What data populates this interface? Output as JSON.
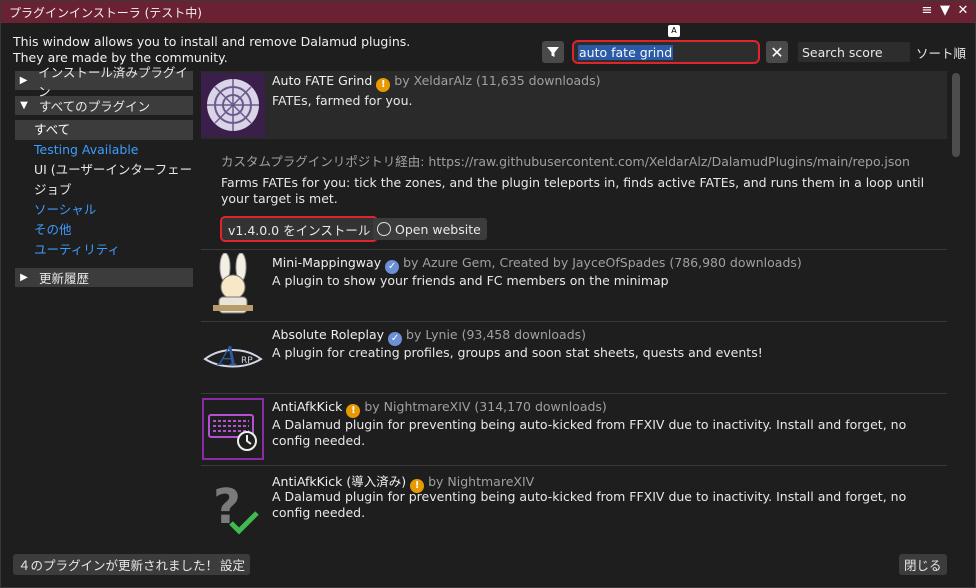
{
  "window": {
    "title": "プラグインインストーラ (テスト中)",
    "controls": [
      "menu-icon",
      "collapse-icon",
      "close-icon"
    ]
  },
  "intro": {
    "line1": "This window allows you to install and remove Dalamud plugins.",
    "line2": "They are made by the community."
  },
  "search": {
    "value": "auto fate grind",
    "ime_indicator": "A",
    "sort_value": "Search score",
    "sort_label": "ソート順"
  },
  "sidebar": {
    "installed": "インストール済みプラグイン",
    "all": "すべてのプラグイン",
    "sub_items": [
      {
        "label": "すべて"
      },
      {
        "label": "Testing Available"
      },
      {
        "label": "UI (ユーザーインターフェース)"
      },
      {
        "label": "ジョブ"
      },
      {
        "label": "ソーシャル"
      },
      {
        "label": "その他"
      },
      {
        "label": "ユーティリティ"
      }
    ],
    "changelog": "更新履歴"
  },
  "plugins": [
    {
      "name": "Auto FATE Grind",
      "by": "by XeldarAlz (11,635 downloads)",
      "summary": "FATEs, farmed for you.",
      "repo": "カスタムプラグインリポジトリ経由: https://raw.githubusercontent.com/XeldarAlz/DalamudPlugins/main/repo.json",
      "description": "Farms FATEs for you: tick the zones, and the plugin teleports in, finds active FATEs, and runs them in a loop until your target is met.",
      "install_label": "v1.4.0.0 をインストール",
      "website_label": "Open website"
    },
    {
      "name": "Mini-Mappingway",
      "by": "by Azure Gem, Created by JayceOfSpades (786,980 downloads)",
      "summary": "A plugin to show your friends and FC members on the minimap"
    },
    {
      "name": "Absolute Roleplay",
      "by": "by Lynie (93,458 downloads)",
      "summary": "A plugin for creating profiles, groups and soon stat sheets, quests and events!"
    },
    {
      "name": "AntiAfkKick",
      "by": "by NightmareXIV (314,170 downloads)",
      "summary": "A Dalamud plugin for preventing being auto-kicked from FFXIV due to inactivity. Install and forget, no config needed."
    },
    {
      "name": "AntiAfkKick (導入済み)",
      "by": "by NightmareXIV",
      "summary": "A Dalamud plugin for preventing being auto-kicked from FFXIV due to inactivity. Install and forget, no config needed."
    }
  ],
  "badge_glyphs": {
    "warning": "!",
    "verified": "✓"
  },
  "thumb_text": {
    "roleplay_mark": "RP"
  },
  "footer": {
    "updates": "４のプラグインが更新されました！",
    "settings": "設定",
    "close": "閉じる"
  },
  "colors": {
    "title_bar": "#6a2232",
    "link_blue": "#3d9cff",
    "highlight_red": "#e0242c",
    "warning_orange": "#e69a00"
  }
}
